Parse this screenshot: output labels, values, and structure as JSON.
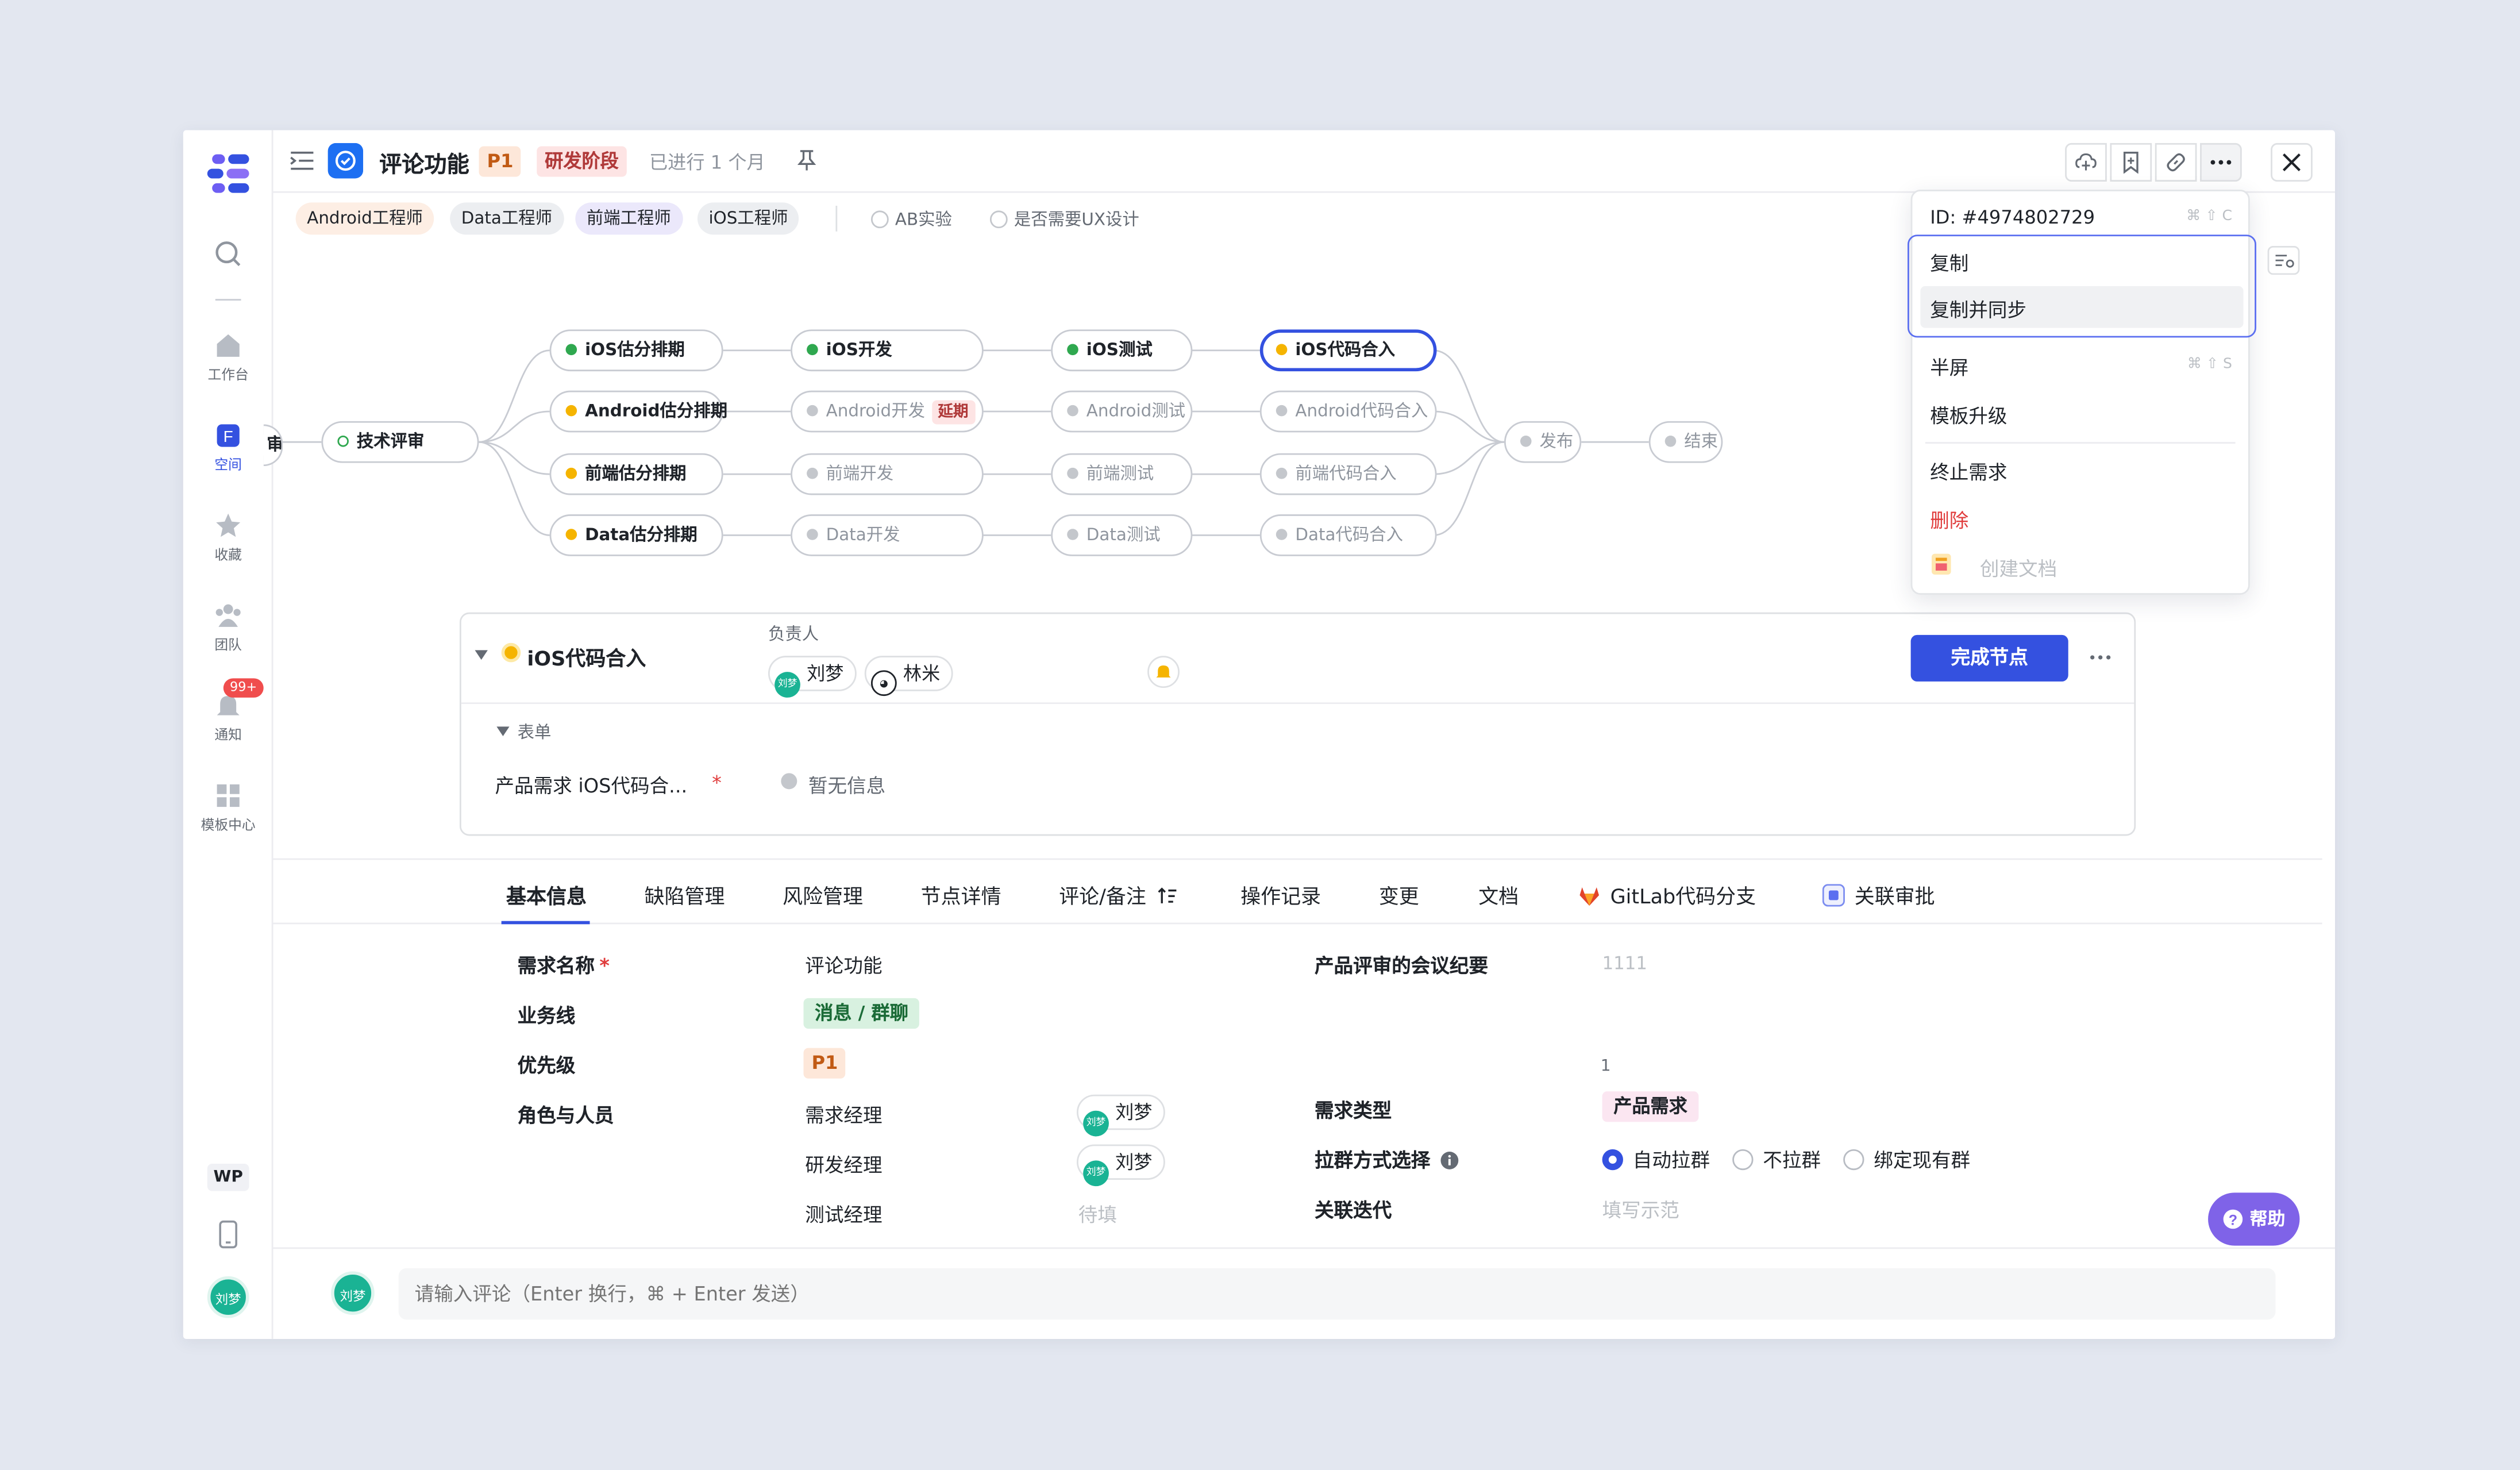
{
  "sidebar": {
    "items": [
      {
        "label": "工作台",
        "icon": "home-icon"
      },
      {
        "label": "空间",
        "icon": "space-icon",
        "active": true
      },
      {
        "label": "收藏",
        "icon": "star-icon"
      },
      {
        "label": "团队",
        "icon": "team-icon"
      },
      {
        "label": "通知",
        "icon": "bell-icon",
        "badge": "99+"
      },
      {
        "label": "模板中心",
        "icon": "template-icon"
      }
    ],
    "workspace_badge": "WP",
    "user_avatar": "刘梦"
  },
  "header": {
    "title": "评论功能",
    "priority": "P1",
    "phase": "研发阶段",
    "duration": "已进行 1 个月"
  },
  "roles": [
    "Android工程师",
    "Data工程师",
    "前端工程师",
    "iOS工程师"
  ],
  "toggles": [
    "AB实验",
    "是否需要UX设计"
  ],
  "flow": {
    "start_partial": "审",
    "review": "技术评审",
    "rows": [
      [
        "iOS估分排期",
        "iOS开发",
        "iOS测试",
        "iOS代码合入"
      ],
      [
        "Android估分排期",
        "Android开发",
        "Android测试",
        "Android代码合入"
      ],
      [
        "前端估分排期",
        "前端开发",
        "前端测试",
        "前端代码合入"
      ],
      [
        "Data估分排期",
        "Data开发",
        "Data测试",
        "Data代码合入"
      ]
    ],
    "delay_label": "延期",
    "publish": "发布",
    "end": "结束"
  },
  "node_card": {
    "title": "iOS代码合入",
    "owner_label": "负责人",
    "owners": [
      "刘梦",
      "林米"
    ],
    "complete_button": "完成节点",
    "form_section": "表单",
    "form_field": "产品需求 iOS代码合...",
    "form_value": "暂无信息"
  },
  "tabs": [
    "基本信息",
    "缺陷管理",
    "风险管理",
    "节点详情",
    "评论/备注",
    "操作记录",
    "变更",
    "文档",
    "GitLab代码分支",
    "关联审批"
  ],
  "basic_info": {
    "name_label": "需求名称",
    "name_value": "评论功能",
    "biz_label": "业务线",
    "biz_value": "消息 / 群聊",
    "priority_label": "优先级",
    "priority_value": "P1",
    "roles_label": "角色与人员",
    "pm_label": "需求经理",
    "pm_value": "刘梦",
    "dev_label": "研发经理",
    "dev_value": "刘梦",
    "qa_label": "测试经理",
    "qa_value": "待填",
    "minutes_label": "产品评审的会议纪要",
    "minutes_value": "1111",
    "minutes_value2": "1",
    "type_label": "需求类型",
    "type_value": "产品需求",
    "group_label": "拉群方式选择",
    "group_options": [
      "自动拉群",
      "不拉群",
      "绑定现有群"
    ],
    "iteration_label": "关联迭代",
    "iteration_placeholder": "填写示范"
  },
  "comment": {
    "avatar": "刘梦",
    "placeholder": "请输入评论（Enter 换行，⌘ + Enter 发送）"
  },
  "help_label": "帮助",
  "menu": {
    "id": "ID: #4974802729",
    "id_shortcut": "⌘ ⇧ C",
    "copy": "复制",
    "copy_sync": "复制并同步",
    "half_screen": "半屏",
    "half_shortcut": "⌘ ⇧ S",
    "template_upgrade": "模板升级",
    "terminate": "终止需求",
    "delete": "删除",
    "create_doc": "创建文档"
  },
  "colors": {
    "accent": "#3451e0",
    "danger": "#e03c3c",
    "help": "#7f63e8",
    "avatar": "#1ab394"
  }
}
